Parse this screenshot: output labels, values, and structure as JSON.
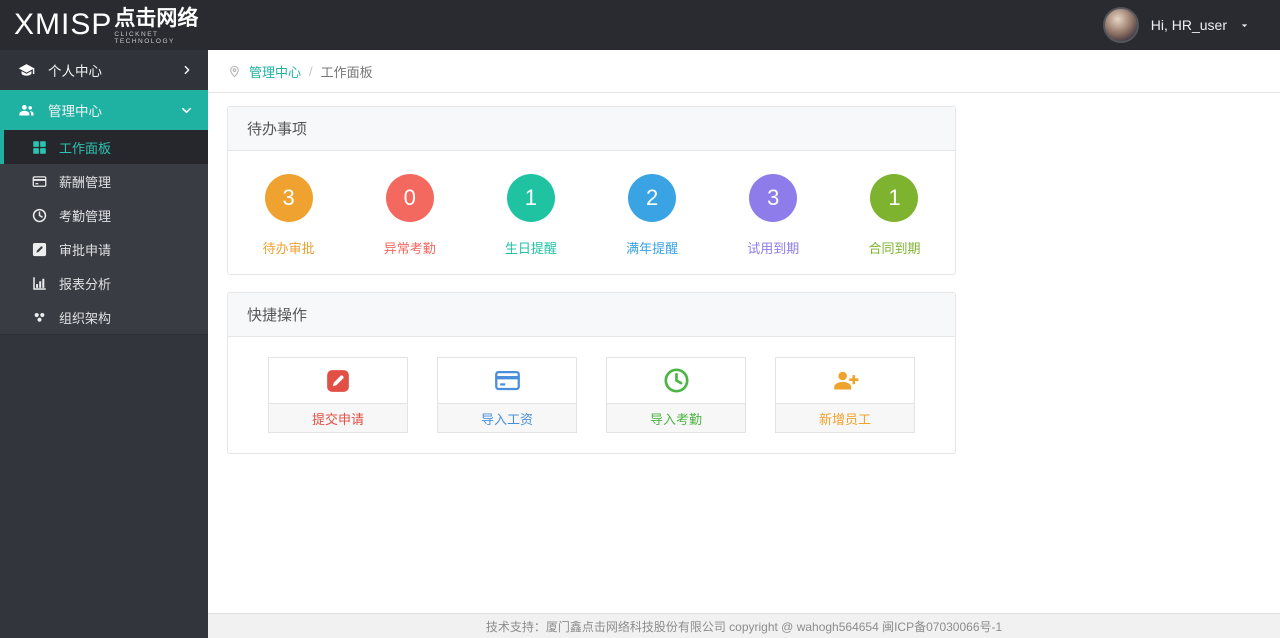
{
  "topbar": {
    "logo_text": "XMISP",
    "logo_cn": "点击网络",
    "logo_subtitle": "CLICKNET TECHNOLOGY",
    "greeting": "Hi, HR_user"
  },
  "sidebar": {
    "personal": {
      "label": "个人中心",
      "icon": "graduation-cap-icon"
    },
    "manage": {
      "label": "管理中心",
      "icon": "users-icon",
      "expanded": true
    },
    "submenu": [
      {
        "label": "工作面板",
        "icon": "grid-icon",
        "active": true
      },
      {
        "label": "薪酬管理",
        "icon": "credit-card-icon"
      },
      {
        "label": "考勤管理",
        "icon": "clock-icon"
      },
      {
        "label": "审批申请",
        "icon": "pencil-square-icon"
      },
      {
        "label": "报表分析",
        "icon": "bar-chart-icon"
      },
      {
        "label": "组织架构",
        "icon": "org-nodes-icon"
      }
    ]
  },
  "breadcrumb": {
    "parent": "管理中心",
    "separator": "/",
    "current": "工作面板"
  },
  "todo_panel": {
    "title": "待办事项",
    "items": [
      {
        "count": "3",
        "label": "待办审批",
        "color": "#efa22f"
      },
      {
        "count": "0",
        "label": "异常考勤",
        "color": "#f4695f"
      },
      {
        "count": "1",
        "label": "生日提醒",
        "color": "#1fc3a2"
      },
      {
        "count": "2",
        "label": "满年提醒",
        "color": "#3aa3e3"
      },
      {
        "count": "3",
        "label": "试用到期",
        "color": "#8d7ce9"
      },
      {
        "count": "1",
        "label": "合同到期",
        "color": "#7db32e"
      }
    ]
  },
  "quick_panel": {
    "title": "快捷操作",
    "actions": [
      {
        "label": "提交申请",
        "icon": "pencil-square-icon",
        "color": "#e25045"
      },
      {
        "label": "导入工资",
        "icon": "credit-card-icon",
        "color": "#4a8fdc"
      },
      {
        "label": "导入考勤",
        "icon": "clock-icon",
        "color": "#4db544"
      },
      {
        "label": "新增员工",
        "icon": "user-plus-icon",
        "color": "#f0a32c"
      }
    ]
  },
  "footer": {
    "text": "技术支持：厦门鑫点击网络科技股份有限公司  copyright @ wahogh564654  闽ICP备07030066号-1"
  },
  "colors": {
    "accent": "#1fb2a3",
    "accent_bright": "#2cc3b1"
  }
}
